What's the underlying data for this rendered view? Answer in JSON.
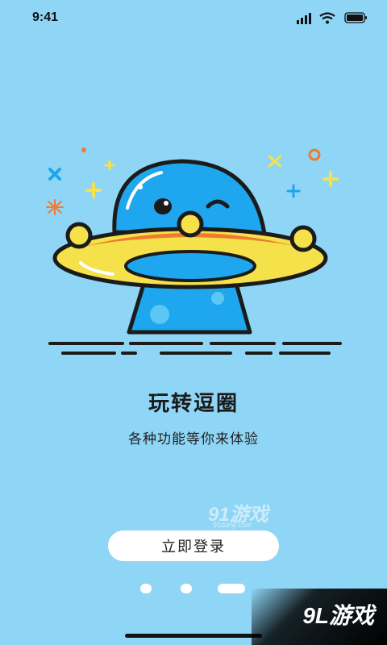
{
  "status_bar": {
    "time": "9:41",
    "icons": [
      "signal-icon",
      "wifi-icon",
      "battery-icon"
    ]
  },
  "onboarding": {
    "title": "玩转逗圈",
    "subtitle": "各种功能等你来体验",
    "login_button": "立即登录",
    "pager": {
      "count": 3,
      "active_index": 2
    }
  },
  "watermarks": {
    "center": "91游戏",
    "center_sub": "91danji.com",
    "corner": "9L游戏"
  },
  "colors": {
    "background": "#8fd6f6",
    "alien": "#1ea6ee",
    "ufo_yellow": "#f5e14a",
    "ufo_orange": "#f07a2e",
    "outline": "#1b1b1b"
  }
}
